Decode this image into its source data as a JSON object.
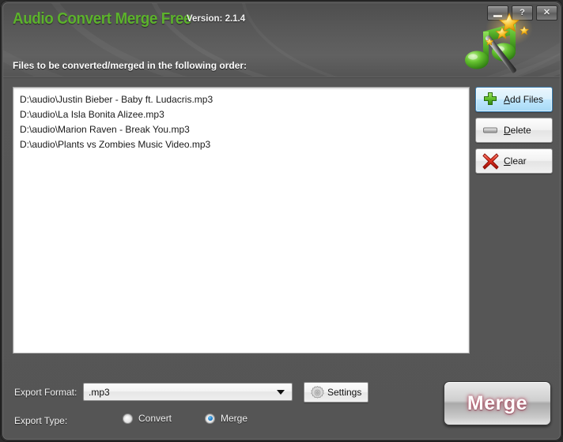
{
  "window": {
    "title": "Audio Convert Merge Free",
    "version_label": "Version: 2.1.4",
    "controls": {
      "minimize": "minimize",
      "help": "?",
      "close": "✕"
    }
  },
  "header": {
    "section_label": "Files to be converted/merged in the following order:",
    "logo_name": "music-note-magic-wand-logo",
    "title_color": "#5cb22c"
  },
  "file_list": {
    "items": [
      "D:\\audio\\Justin Bieber - Baby ft. Ludacris.mp3",
      "D:\\audio\\La Isla Bonita Alizee.mp3",
      "D:\\audio\\Marion Raven - Break You.mp3",
      "D:\\audio\\Plants vs Zombies Music Video.mp3"
    ]
  },
  "side_buttons": [
    {
      "id": "add-files",
      "label_prefix": "",
      "accel": "A",
      "label_suffix": "dd Files",
      "icon": "plus-icon",
      "focused": true
    },
    {
      "id": "delete",
      "label_prefix": "",
      "accel": "D",
      "label_suffix": "elete",
      "icon": "minus-icon",
      "focused": false
    },
    {
      "id": "clear",
      "label_prefix": "",
      "accel": "C",
      "label_suffix": "lear",
      "icon": "red-x-icon",
      "focused": false
    }
  ],
  "options": {
    "format_label": "Export Format:",
    "format_value": ".mp3",
    "settings_label": "Settings",
    "settings_icon": "gear-icon",
    "type_label": "Export Type:",
    "type_options": [
      {
        "id": "convert",
        "label": "Convert",
        "checked": false
      },
      {
        "id": "merge",
        "label": "Merge",
        "checked": true
      }
    ]
  },
  "action": {
    "merge_label": "Merge"
  }
}
